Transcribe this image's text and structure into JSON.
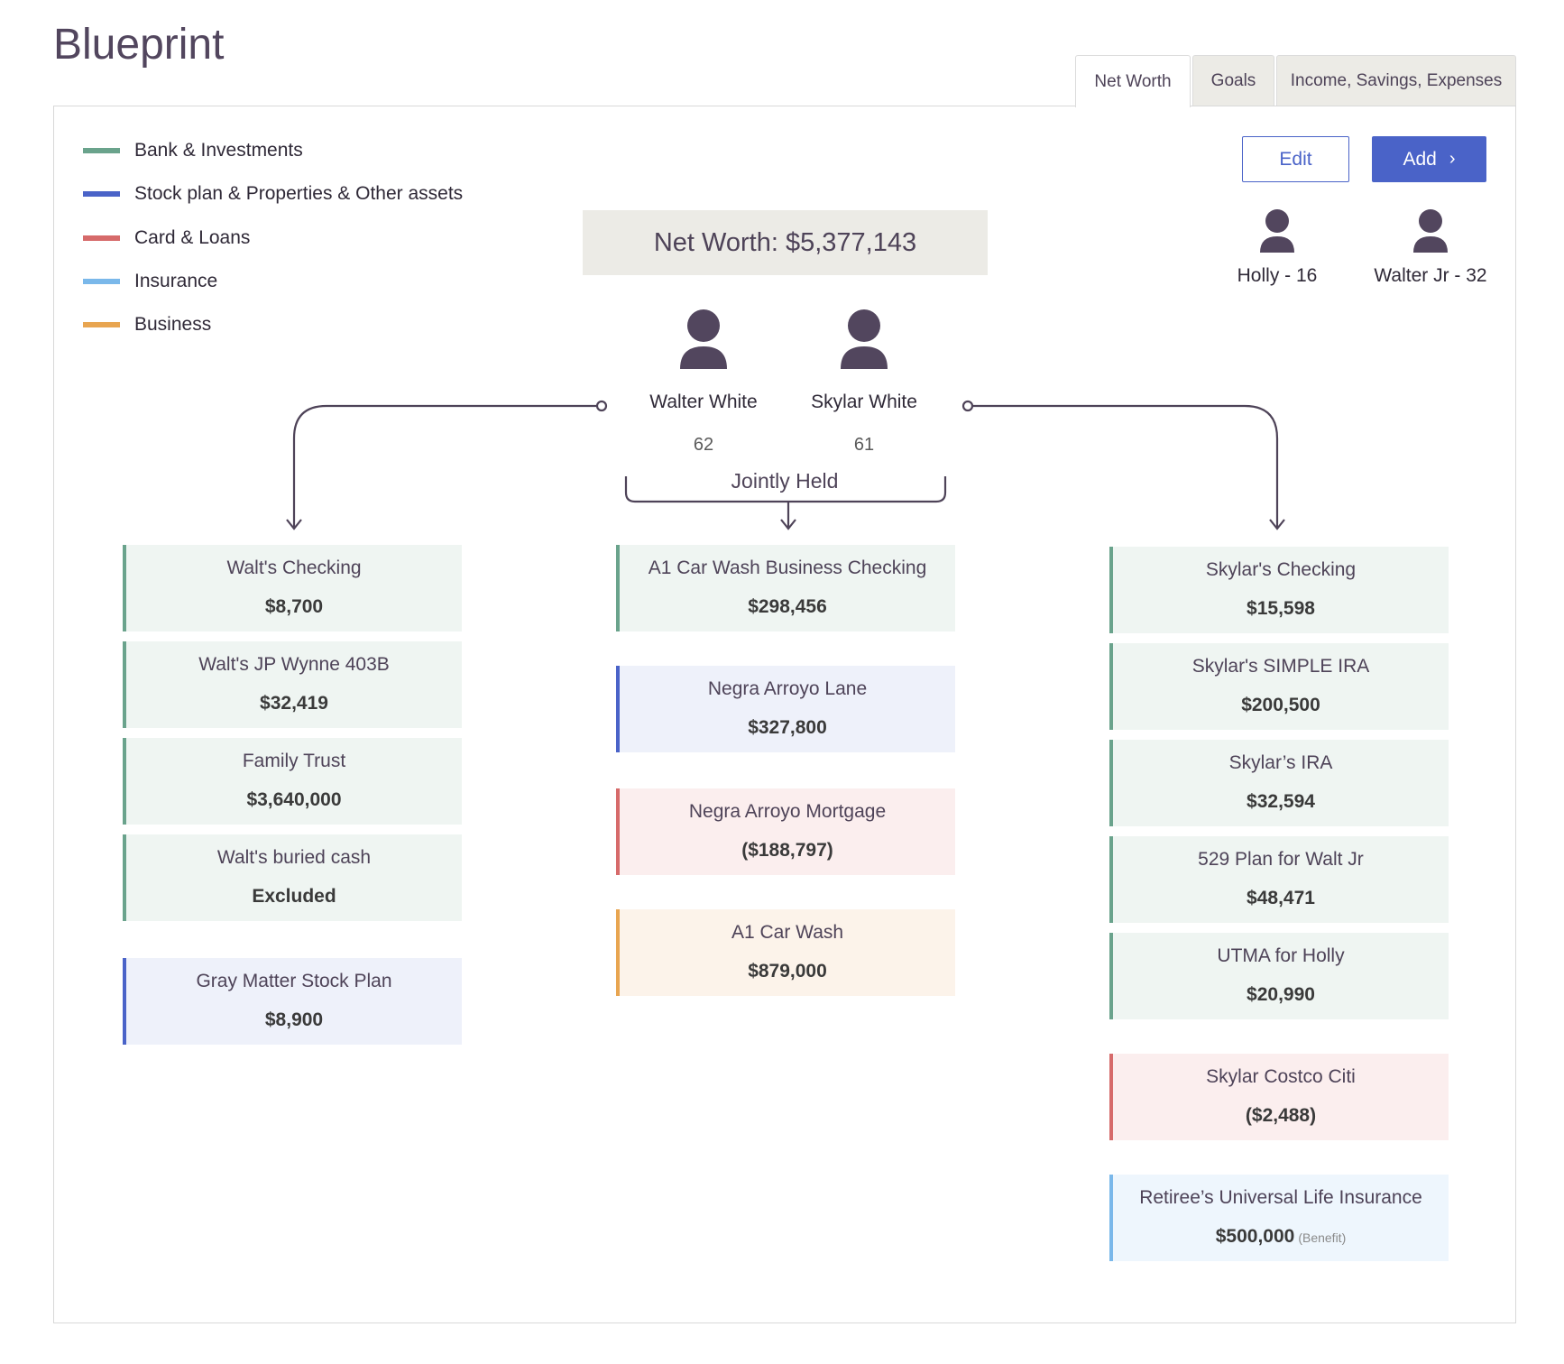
{
  "app": {
    "title": "Blueprint"
  },
  "tabs": [
    {
      "label": "Net Worth",
      "active": true
    },
    {
      "label": "Goals",
      "active": false
    },
    {
      "label": "Income, Savings, Expenses",
      "active": false
    }
  ],
  "legend": [
    {
      "label": "Bank & Investments",
      "color": "#6aa38c"
    },
    {
      "label": "Stock plan & Properties & Other assets",
      "color": "#4a63c8"
    },
    {
      "label": "Card & Loans",
      "color": "#d66a6a"
    },
    {
      "label": "Insurance",
      "color": "#7ab8ea"
    },
    {
      "label": "Business",
      "color": "#e8a550"
    }
  ],
  "toolbar": {
    "edit_label": "Edit",
    "add_label": "Add"
  },
  "net_worth": {
    "text": "Net Worth: $5,377,143"
  },
  "dependents": [
    {
      "name": "Holly - 16",
      "icon": "person-icon"
    },
    {
      "name": "Walter Jr - 32",
      "icon": "person-icon"
    }
  ],
  "owners": [
    {
      "name": "Walter White",
      "age": "62",
      "icon": "person-icon"
    },
    {
      "name": "Skylar White",
      "age": "61",
      "icon": "person-icon"
    }
  ],
  "jointly_label": "Jointly Held",
  "columns": {
    "walter": [
      {
        "name": "Walt's Checking",
        "value": "$8,700",
        "type": "bank"
      },
      {
        "name": "Walt's JP Wynne 403B",
        "value": "$32,419",
        "type": "bank"
      },
      {
        "name": "Family Trust",
        "value": "$3,640,000",
        "type": "bank"
      },
      {
        "name": "Walt's buried cash",
        "value": "Excluded",
        "type": "bank"
      },
      {
        "name": "Gray Matter Stock Plan",
        "value": "$8,900",
        "type": "stock"
      }
    ],
    "joint": [
      {
        "name": "A1 Car Wash Business Checking",
        "value": "$298,456",
        "type": "bank"
      },
      {
        "name": "Negra Arroyo Lane",
        "value": "$327,800",
        "type": "stock"
      },
      {
        "name": "Negra Arroyo Mortgage",
        "value": "($188,797)",
        "type": "loan"
      },
      {
        "name": "A1 Car Wash",
        "value": "$879,000",
        "type": "biz"
      }
    ],
    "skylar": [
      {
        "name": "Skylar's Checking",
        "value": "$15,598",
        "type": "bank"
      },
      {
        "name": "Skylar's SIMPLE IRA",
        "value": "$200,500",
        "type": "bank"
      },
      {
        "name": "Skylar’s IRA",
        "value": "$32,594",
        "type": "bank"
      },
      {
        "name": "529 Plan for Walt Jr",
        "value": "$48,471",
        "type": "bank"
      },
      {
        "name": "UTMA for Holly",
        "value": "$20,990",
        "type": "bank"
      },
      {
        "name": "Skylar Costco Citi",
        "value": "($2,488)",
        "type": "loan"
      },
      {
        "name": "Retiree’s Universal Life Insurance",
        "value": "$500,000",
        "note": "(Benefit)",
        "type": "ins"
      }
    ]
  }
}
